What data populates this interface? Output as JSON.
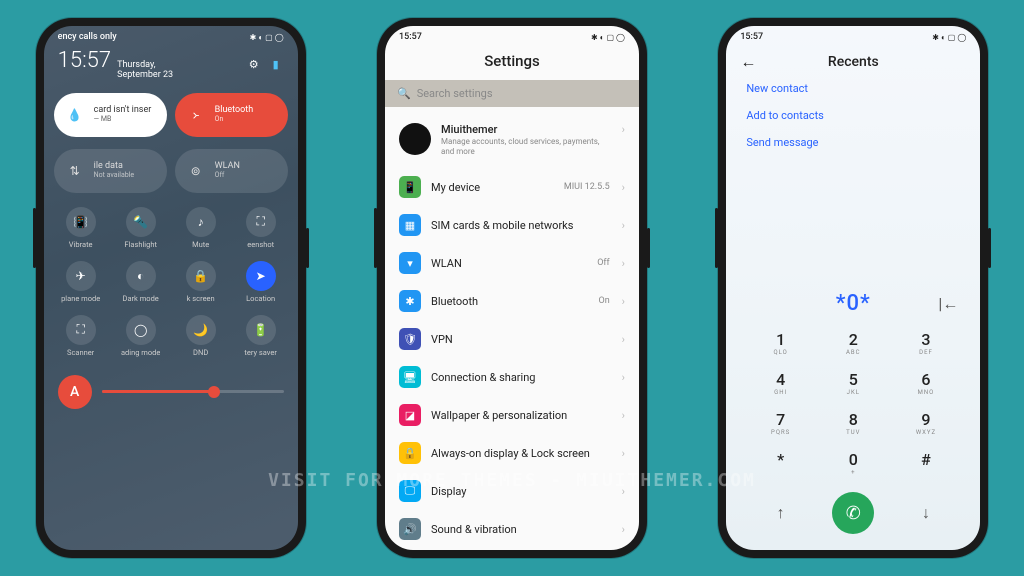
{
  "watermark": "VISIT FOR MORE THEMES - MIUITHEMER.COM",
  "phone1": {
    "status_left": "ency calls only",
    "status_icons": "✱ ◐ ▢ ◯",
    "time": "15:57",
    "date_line1": "Thursday,",
    "date_line2": "September 23",
    "pills": [
      {
        "title": "card isn't inser",
        "sub": "— MB"
      },
      {
        "title": "Bluetooth",
        "sub": "On"
      },
      {
        "title": "ile data",
        "sub": "Not available"
      },
      {
        "title": "WLAN",
        "sub": "Off"
      }
    ],
    "tiles": [
      {
        "icon": "📳",
        "label": "Vibrate"
      },
      {
        "icon": "🔦",
        "label": "Flashlight"
      },
      {
        "icon": "♪",
        "label": "Mute"
      },
      {
        "icon": "⛶",
        "label": "eenshot"
      },
      {
        "icon": "✈",
        "label": "plane mode"
      },
      {
        "icon": "◐",
        "label": "Dark mode"
      },
      {
        "icon": "🔒",
        "label": "k screen"
      },
      {
        "icon": "➤",
        "label": "Location",
        "active": true
      },
      {
        "icon": "⛶",
        "label": "Scanner"
      },
      {
        "icon": "◯",
        "label": "ading mode"
      },
      {
        "icon": "🌙",
        "label": "DND"
      },
      {
        "icon": "🔋",
        "label": "tery saver"
      }
    ],
    "slider_letter": "A"
  },
  "phone2": {
    "time": "15:57",
    "status_icons": "✱ ◐ ▢ ◯",
    "title": "Settings",
    "search_placeholder": "Search settings",
    "profile": {
      "name": "Miuithemer",
      "sub": "Manage accounts, cloud services, payments, and more"
    },
    "items": [
      {
        "color": "#4caf50",
        "icon": "📱",
        "label": "My device",
        "right": "MIUI 12.5.5"
      },
      {
        "color": "#2196f3",
        "icon": "▦",
        "label": "SIM cards & mobile networks",
        "right": ""
      },
      {
        "color": "#2196f3",
        "icon": "▾",
        "label": "WLAN",
        "right": "Off"
      },
      {
        "color": "#2196f3",
        "icon": "✱",
        "label": "Bluetooth",
        "right": "On"
      },
      {
        "color": "#3f51b5",
        "icon": "🛡",
        "label": "VPN",
        "right": ""
      },
      {
        "color": "#00bcd4",
        "icon": "🖥",
        "label": "Connection & sharing",
        "right": ""
      },
      {
        "color": "#e91e63",
        "icon": "◪",
        "label": "Wallpaper & personalization",
        "right": ""
      },
      {
        "color": "#ffc107",
        "icon": "🔒",
        "label": "Always-on display & Lock screen",
        "right": ""
      },
      {
        "color": "#03a9f4",
        "icon": "🖵",
        "label": "Display",
        "right": ""
      },
      {
        "color": "#607d8b",
        "icon": "🔊",
        "label": "Sound & vibration",
        "right": ""
      }
    ]
  },
  "phone3": {
    "time": "15:57",
    "status_icons": "✱ ◐ ▢ ◯",
    "title": "Recents",
    "actions": [
      "New contact",
      "Add to contacts",
      "Send message"
    ],
    "number": "*0*",
    "keys": [
      {
        "n": "1",
        "l": "QLO"
      },
      {
        "n": "2",
        "l": "ABC"
      },
      {
        "n": "3",
        "l": "DEF"
      },
      {
        "n": "4",
        "l": "GHI"
      },
      {
        "n": "5",
        "l": "JKL"
      },
      {
        "n": "6",
        "l": "MNO"
      },
      {
        "n": "7",
        "l": "PQRS"
      },
      {
        "n": "8",
        "l": "TUV"
      },
      {
        "n": "9",
        "l": "WXYZ"
      },
      {
        "n": "*",
        "l": ""
      },
      {
        "n": "0",
        "l": "+"
      },
      {
        "n": "#",
        "l": ""
      }
    ]
  }
}
